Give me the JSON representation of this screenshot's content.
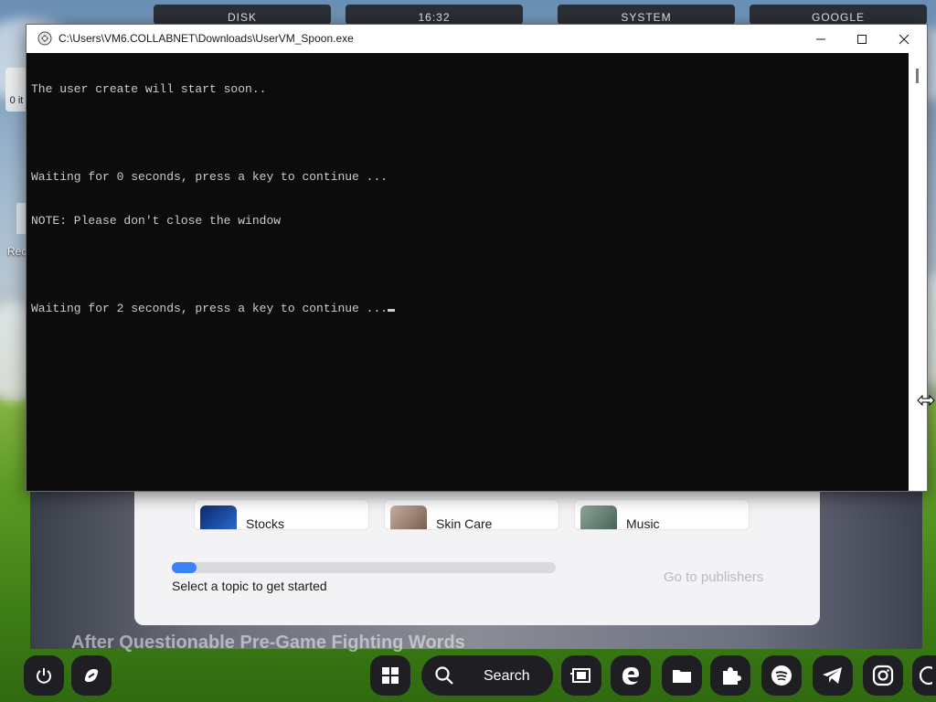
{
  "top_widgets": [
    "DISK",
    "16:32",
    "SYSTEM",
    "GOOGLE"
  ],
  "desktop": {
    "icon_fragment_text": "0 it",
    "recycle_label": "Rec"
  },
  "window": {
    "title": "C:\\Users\\VM6.COLLABNET\\Downloads\\UserVM_Spoon.exe",
    "console_lines": [
      "The user create will start soon..",
      "",
      "Waiting for 0 seconds, press a key to continue ...",
      "NOTE: Please don't close the window",
      "",
      "Waiting for 2 seconds, press a key to continue ..."
    ],
    "icons": {
      "app": "console-app-icon",
      "minimize": "minimize-icon",
      "maximize": "maximize-icon",
      "close": "close-icon"
    }
  },
  "widgets": {
    "topics": [
      {
        "label": "Stocks",
        "thumb_color": "#1e3a8a"
      },
      {
        "label": "Skin Care",
        "thumb_color": "#a38b7a"
      },
      {
        "label": "Music",
        "thumb_color": "#5f7a6a"
      }
    ],
    "progress": 0.065,
    "progress_text": "Select a topic to get started",
    "publishers_link": "Go to publishers",
    "headline_fragment": "After Questionable Pre-Game Fighting Words"
  },
  "taskbar": {
    "search_label": "Search",
    "left_buttons": [
      "power-icon",
      "copilot-icon"
    ],
    "buttons": [
      "start-icon",
      "search-icon",
      "film-icon",
      "edge-icon",
      "folder-icon",
      "puzzle-icon",
      "spotify-icon",
      "telegram-icon",
      "instagram-icon",
      "partial-app-icon"
    ],
    "accent": "#3b82f6"
  }
}
